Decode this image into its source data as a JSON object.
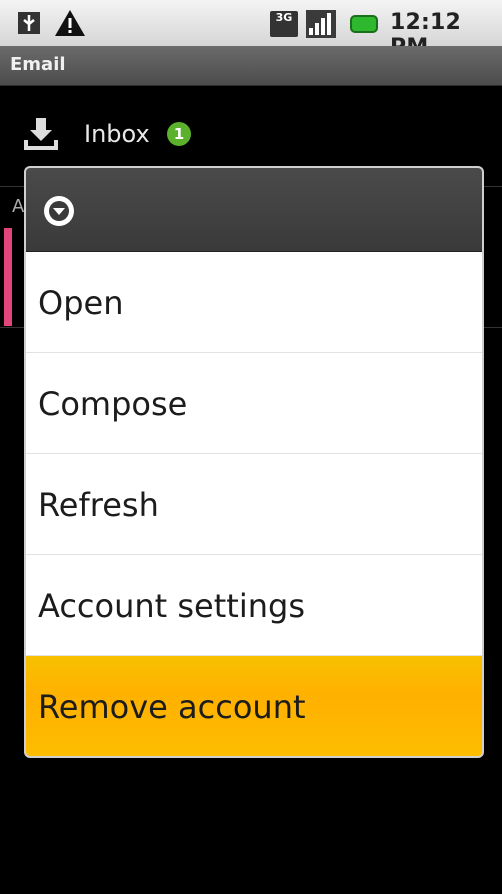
{
  "status_bar": {
    "time": "12:12 PM",
    "network": "3G"
  },
  "app": {
    "title": "Email"
  },
  "background": {
    "inbox_label": "Inbox",
    "unread_count": "1",
    "partial_letter": "A"
  },
  "menu": {
    "items": [
      {
        "label": "Open"
      },
      {
        "label": "Compose"
      },
      {
        "label": "Refresh"
      },
      {
        "label": "Account settings"
      },
      {
        "label": "Remove account"
      }
    ]
  },
  "colors": {
    "highlight": "#fdbd00",
    "accent_pink": "#e0457b",
    "badge_green": "#5bb02c"
  }
}
